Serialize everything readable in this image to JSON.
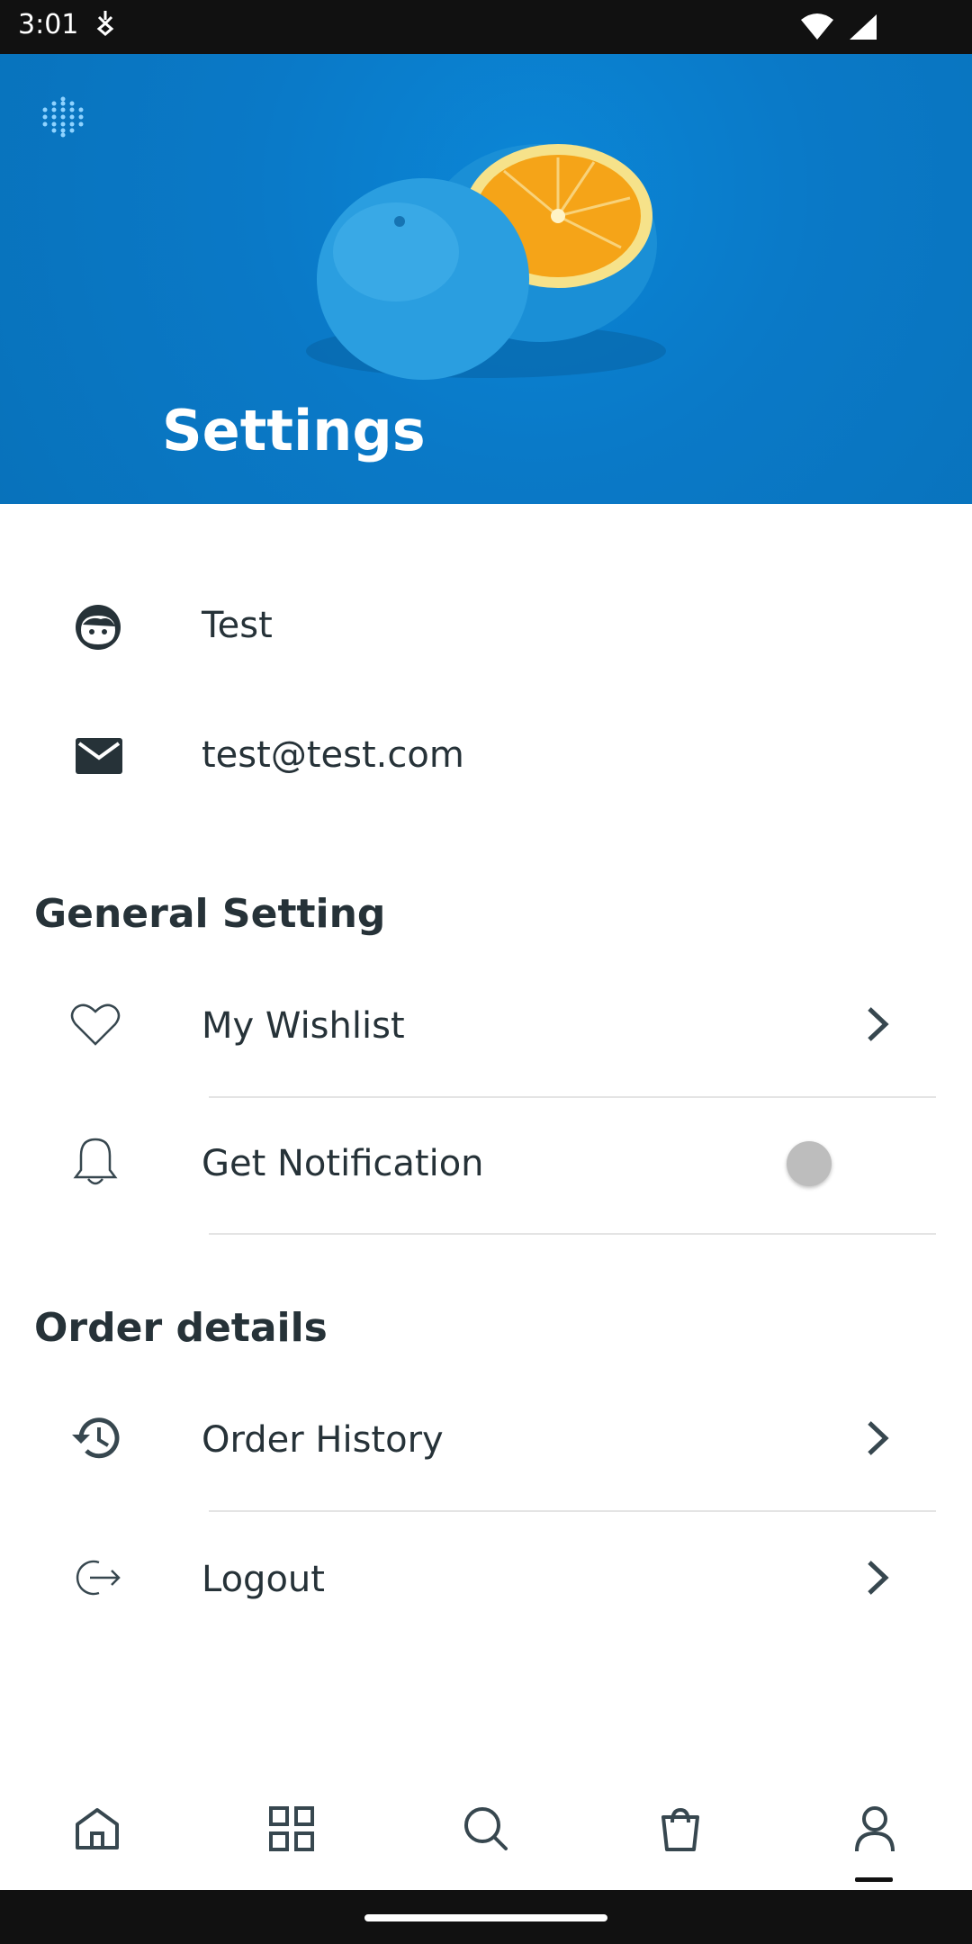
{
  "status_bar": {
    "time": "3:01"
  },
  "header": {
    "title": "Settings"
  },
  "profile": {
    "name": "Test",
    "email": "test@test.com"
  },
  "general": {
    "title": "General Setting",
    "items": [
      {
        "label": "My Wishlist"
      },
      {
        "label": "Get Notification",
        "toggle_on": false
      }
    ]
  },
  "orders": {
    "title": "Order details",
    "items": [
      {
        "label": "Order History"
      },
      {
        "label": "Logout"
      }
    ]
  },
  "bottom_nav": {
    "items": [
      {
        "icon": "home-icon"
      },
      {
        "icon": "grid-icon"
      },
      {
        "icon": "search-icon"
      },
      {
        "icon": "bag-icon"
      },
      {
        "icon": "profile-icon",
        "active": true
      }
    ]
  },
  "colors": {
    "hero_blue": "#0a79c7",
    "text_dark": "#263238",
    "divider": "#e4e4e4"
  }
}
